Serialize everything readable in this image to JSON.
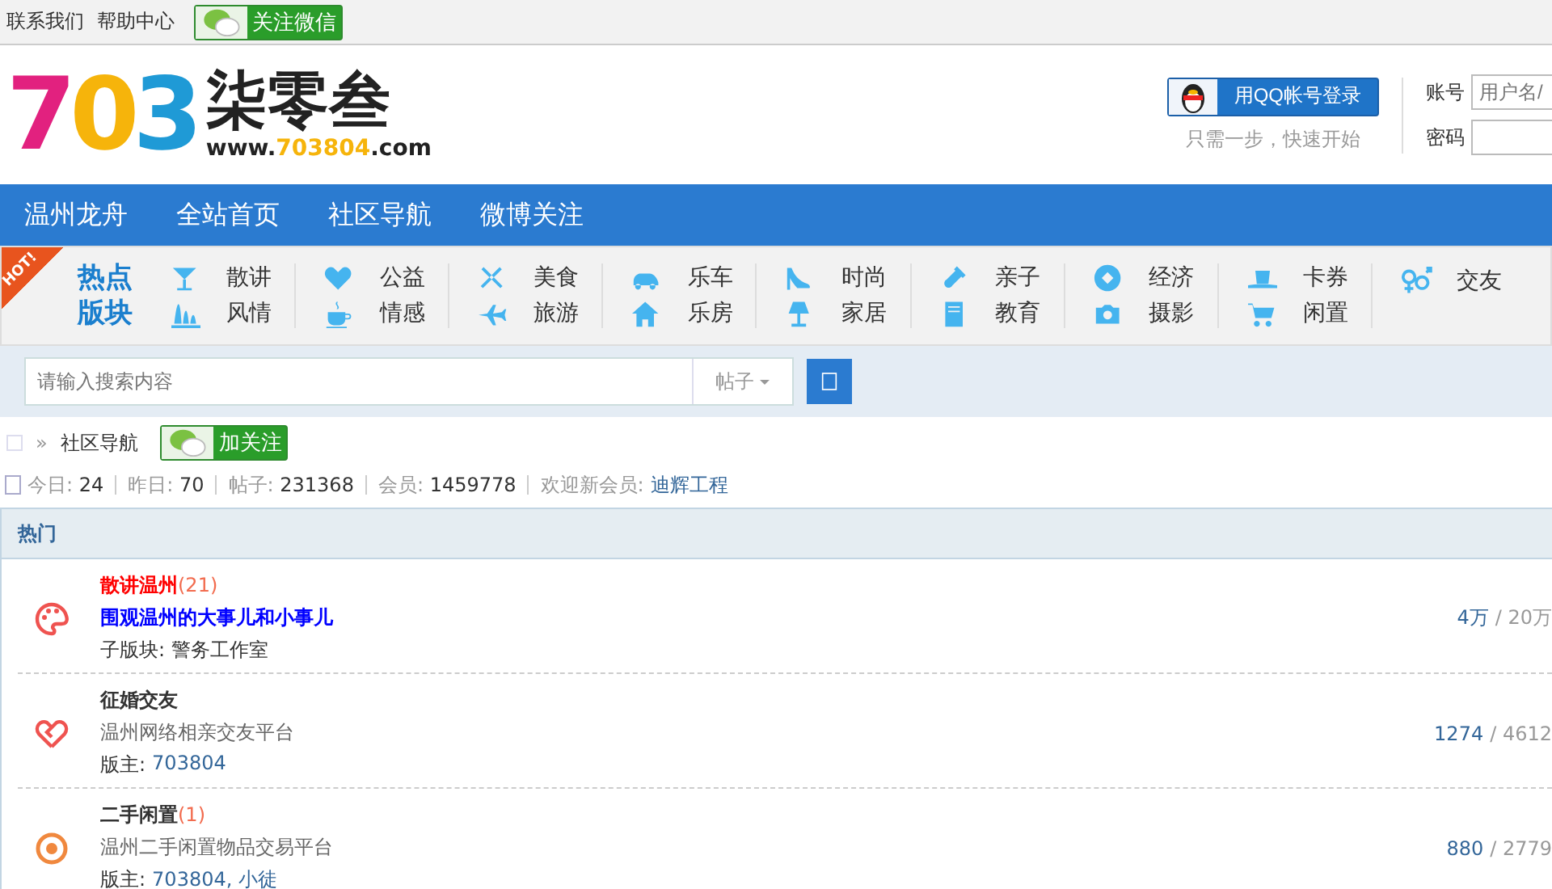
{
  "top_bar": {
    "links": [
      "联系我们",
      "帮助中心"
    ],
    "wechat_button": "关注微信"
  },
  "logo": {
    "mark": "703",
    "name": "柒零叁",
    "domain_prefix": "www.",
    "domain_number": "703804",
    "domain_suffix": ".com"
  },
  "login": {
    "qq_button": "用QQ帐号登录",
    "qq_hint": "只需一步，快速开始",
    "account_label": "账号",
    "account_placeholder": "用户名/",
    "password_label": "密码"
  },
  "nav": [
    "温州龙舟",
    "全站首页",
    "社区导航",
    "微博关注"
  ],
  "hot": {
    "badge": "HOT!",
    "label": "热点版块",
    "groups": [
      [
        "散讲",
        "风情"
      ],
      [
        "公益",
        "情感"
      ],
      [
        "美食",
        "旅游"
      ],
      [
        "乐车",
        "乐房"
      ],
      [
        "时尚",
        "家居"
      ],
      [
        "亲子",
        "教育"
      ],
      [
        "经济",
        "摄影"
      ],
      [
        "卡券",
        "闲置"
      ],
      [
        "交友"
      ]
    ]
  },
  "search": {
    "placeholder": "请输入搜索内容",
    "type": "帖子"
  },
  "breadcrumb": {
    "separator": "»",
    "current": "社区导航",
    "follow_button": "加关注"
  },
  "stats": [
    {
      "label": "今日:",
      "value": "24"
    },
    {
      "label": "昨日:",
      "value": "70"
    },
    {
      "label": "帖子:",
      "value": "231368"
    },
    {
      "label": "会员:",
      "value": "1459778"
    }
  ],
  "welcome": {
    "label": "欢迎新会员:",
    "member": "迪辉工程"
  },
  "forum": {
    "title": "热门",
    "rows": [
      {
        "name": "散讲温州",
        "highlight": true,
        "count": "(21)",
        "description": "围观温州的大事儿和小事儿",
        "description_highlight": true,
        "sub_label": "子版块:",
        "sub_value": "警务工作室",
        "sub_link": false,
        "today": "4万",
        "total": "/ 20万"
      },
      {
        "name": "征婚交友",
        "highlight": false,
        "description": "温州网络相亲交友平台",
        "description_highlight": false,
        "sub_label": "版主:",
        "sub_value": "703804",
        "sub_link": true,
        "today": "1274",
        "total": "/ 4612"
      },
      {
        "name": "二手闲置",
        "highlight": false,
        "count": "(1)",
        "description": "温州二手闲置物品交易平台",
        "description_highlight": false,
        "sub_label": "版主:",
        "sub_value": "703804, 小徒",
        "sub_link": true,
        "today": "880",
        "total": "/ 2779"
      }
    ]
  }
}
